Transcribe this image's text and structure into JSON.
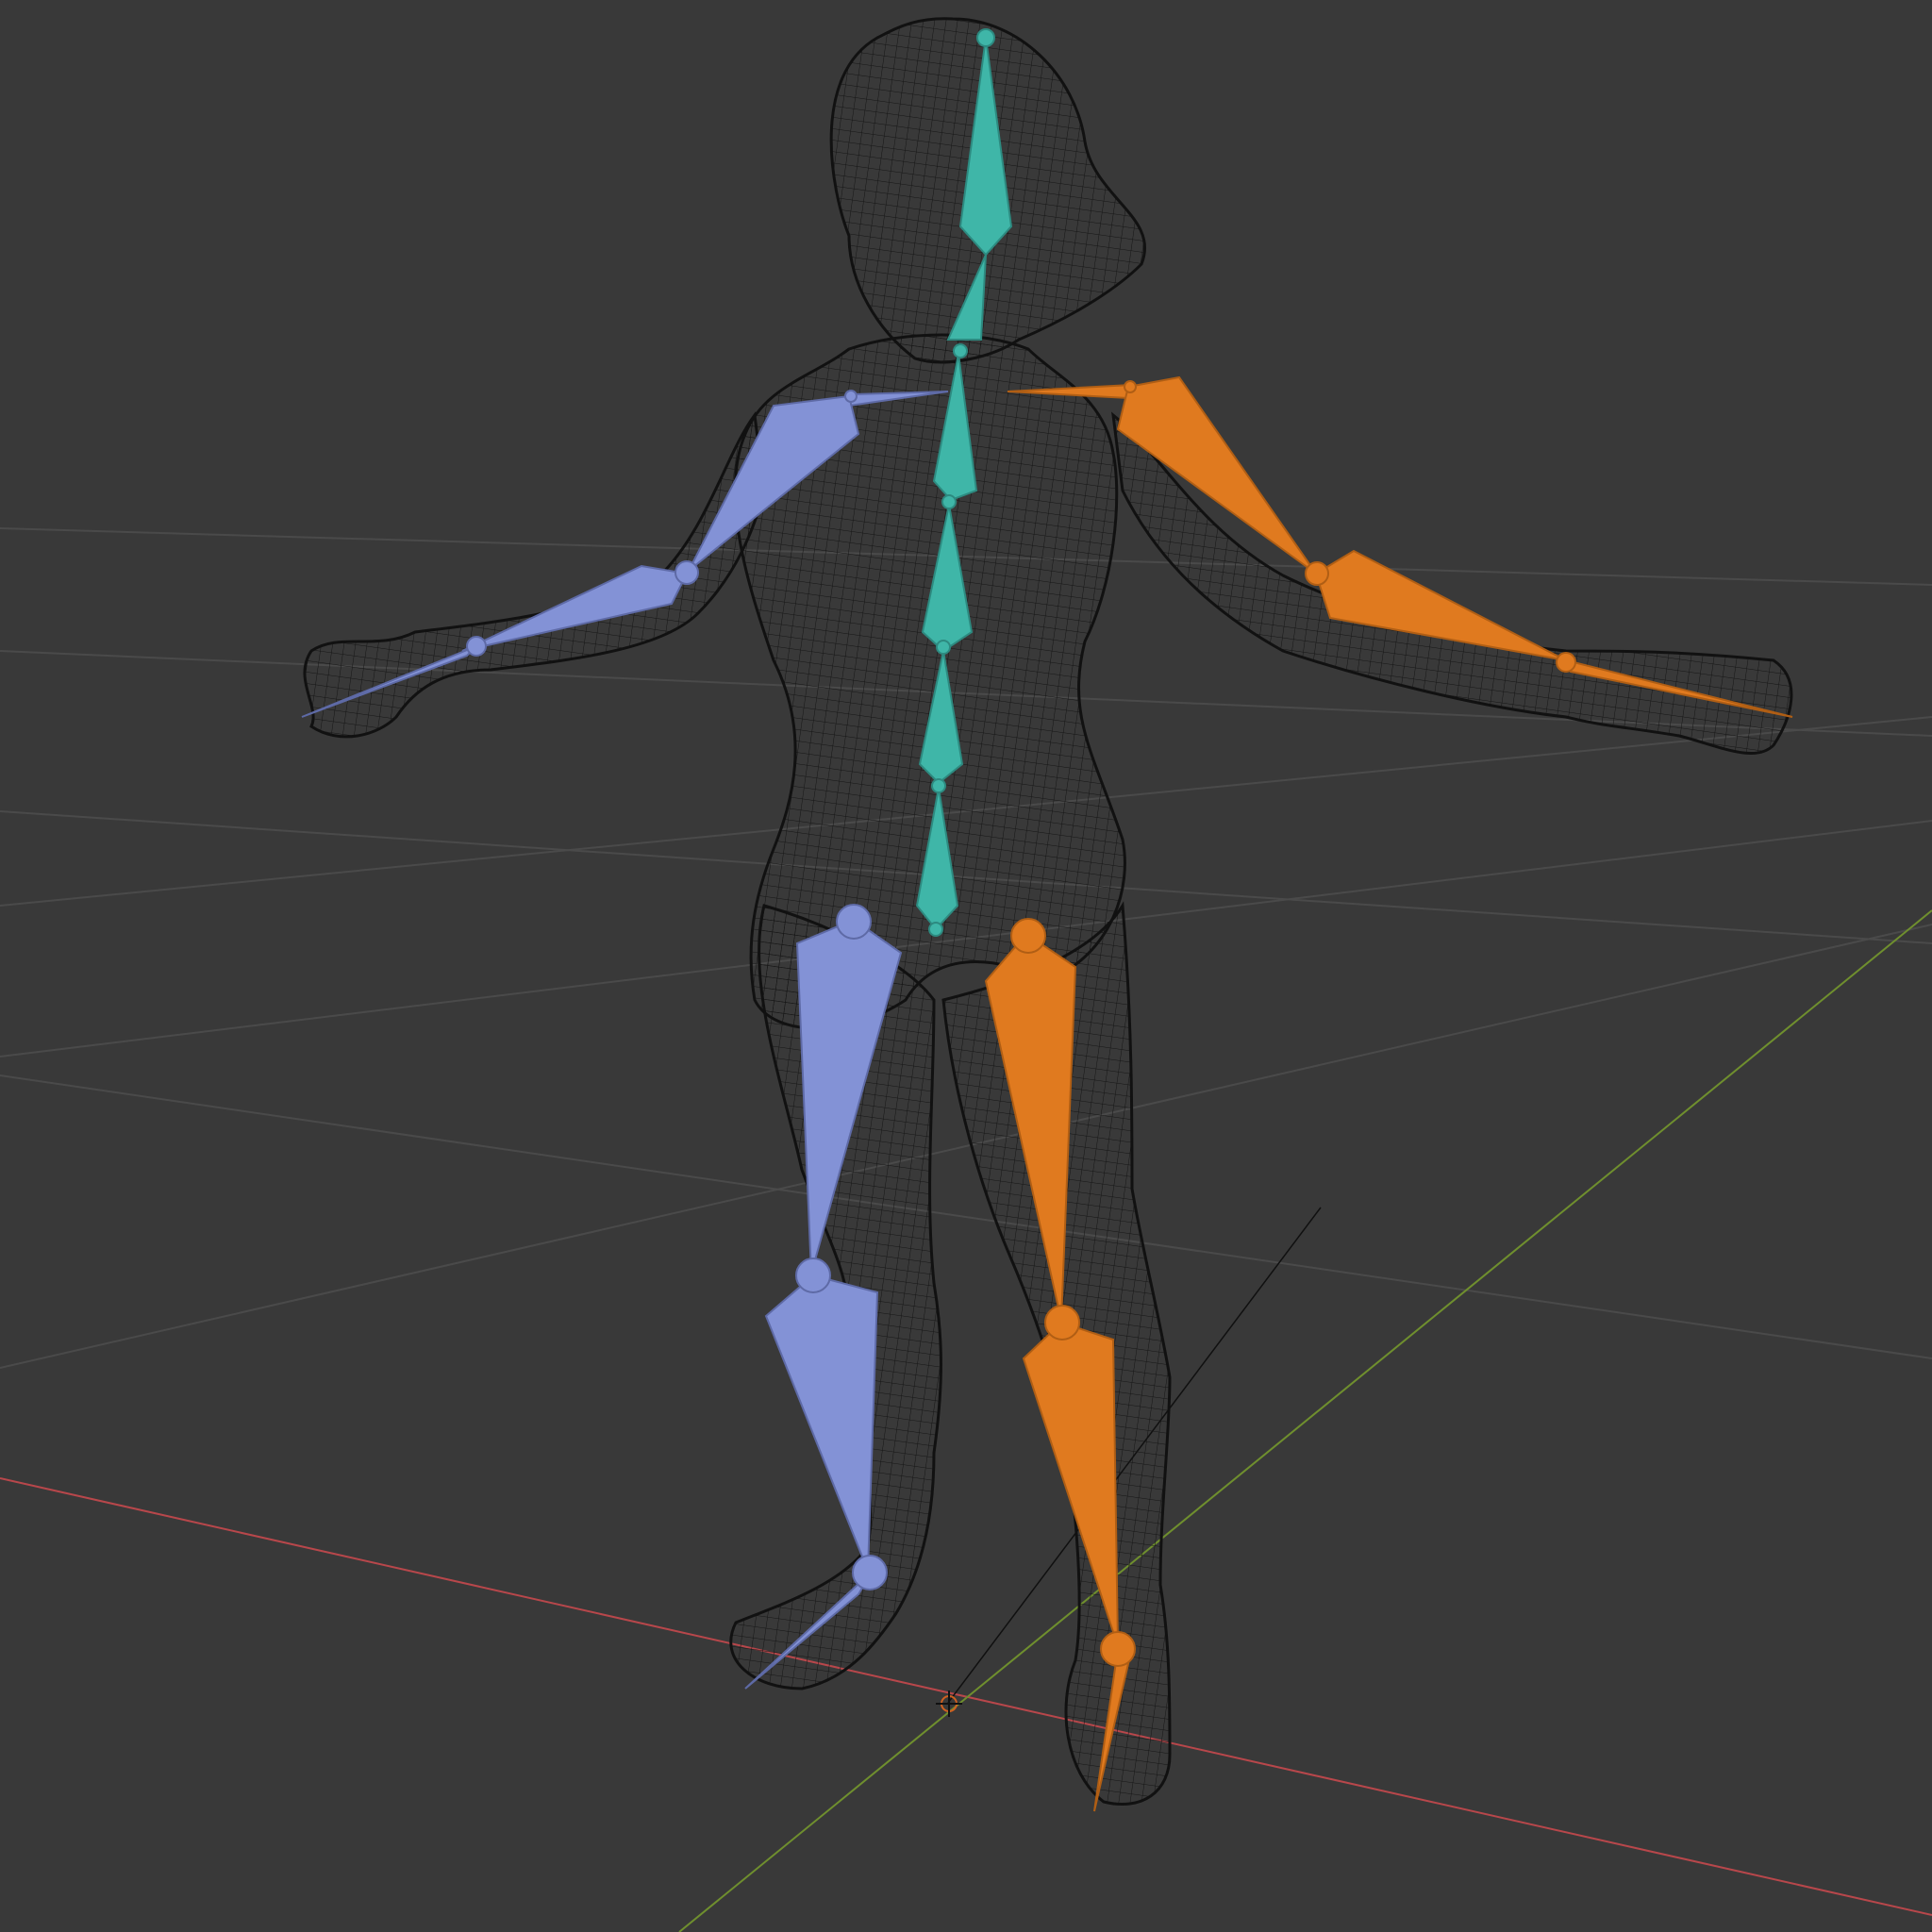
{
  "viewport": {
    "background": "#393939",
    "grid_color": "#4a4a4a",
    "x_axis_color": "#b8474b",
    "y_axis_color": "#6f8f2e"
  },
  "mesh": {
    "wire_color": "#111111"
  },
  "armature": {
    "colors": {
      "spine": "#3fb6a8",
      "left": "#8392d6",
      "right": "#e07a1f"
    }
  },
  "icons": {
    "origin": "3d-cursor-icon"
  }
}
